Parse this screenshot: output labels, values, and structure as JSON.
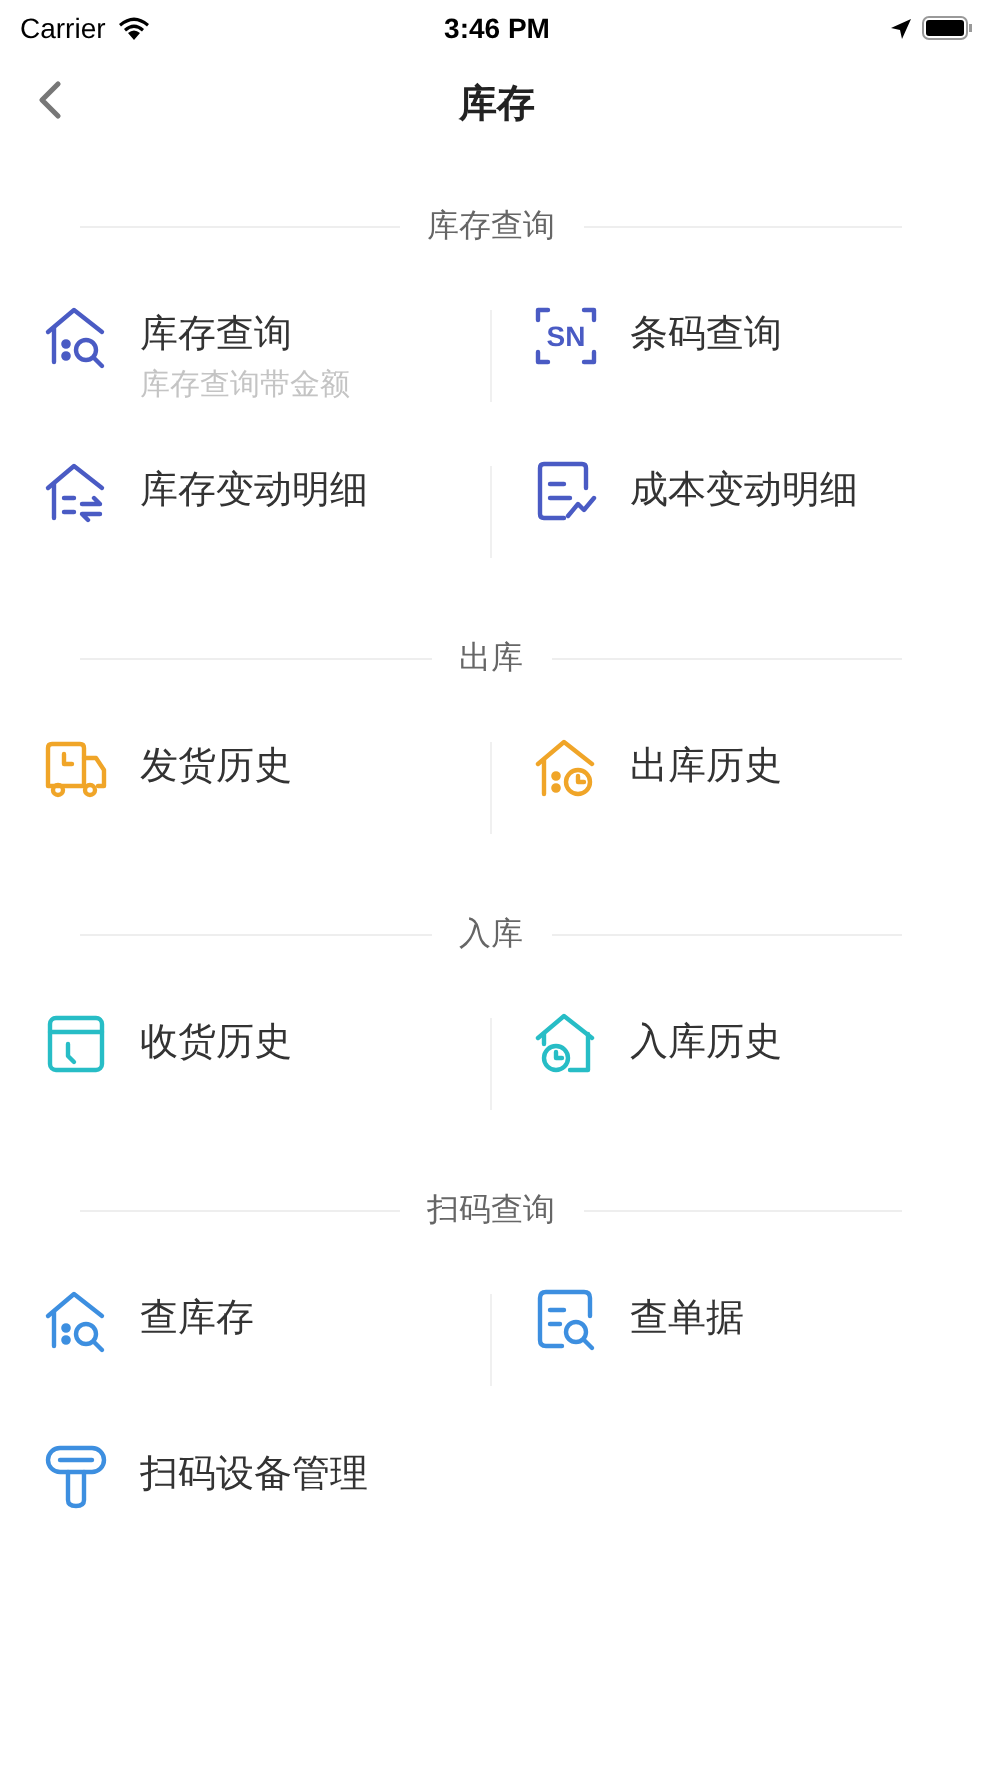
{
  "status_bar": {
    "carrier": "Carrier",
    "time": "3:46 PM"
  },
  "nav": {
    "title": "库存"
  },
  "sections": [
    {
      "title": "库存查询",
      "color": "#4a5bc4",
      "items": [
        {
          "kind": "house-search",
          "label": "库存查询",
          "subtitle": "库存查询带金额"
        },
        {
          "kind": "sn-frame",
          "label": "条码查询",
          "icon_text": "SN"
        },
        {
          "kind": "house-list",
          "label": "库存变动明细"
        },
        {
          "kind": "chart-doc",
          "label": "成本变动明细"
        }
      ]
    },
    {
      "title": "出库",
      "color": "#f0a528",
      "items": [
        {
          "kind": "truck",
          "label": "发货历史"
        },
        {
          "kind": "house-clock",
          "label": "出库历史"
        }
      ]
    },
    {
      "title": "入库",
      "color": "#27bdc6",
      "items": [
        {
          "kind": "box-clock",
          "label": "收货历史"
        },
        {
          "kind": "home-clock",
          "label": "入库历史"
        }
      ]
    },
    {
      "title": "扫码查询",
      "color": "#3d8fe0",
      "items": [
        {
          "kind": "house-search",
          "label": "查库存"
        },
        {
          "kind": "doc-search",
          "label": "查单据"
        },
        {
          "kind": "scanner",
          "label": "扫码设备管理"
        }
      ]
    }
  ]
}
